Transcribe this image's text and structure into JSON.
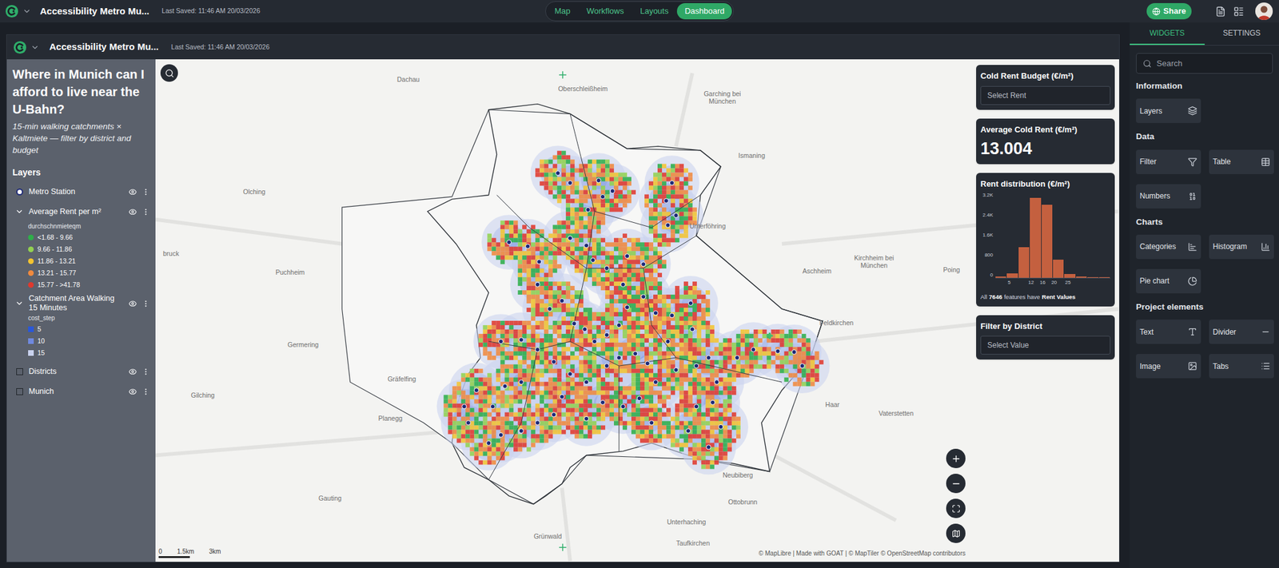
{
  "app_bar": {
    "project_title": "Accessibility Metro Mu...",
    "last_saved": "Last Saved: 11:46 AM 20/03/2026",
    "tabs": [
      {
        "label": "Map",
        "selected": false
      },
      {
        "label": "Workflows",
        "selected": false
      },
      {
        "label": "Layouts",
        "selected": false
      },
      {
        "label": "Dashboard",
        "selected": true
      }
    ],
    "share": "Share"
  },
  "dashboard_header": {
    "project_title": "Accessibility Metro Mu...",
    "last_saved": "Last Saved: 11:46 AM 20/03/2026"
  },
  "left_panel": {
    "title": "Where in Munich can I afford to live near the U-Bahn?",
    "subtitle": "15-min walking catchments × Kaltmiete — filter by district and budget",
    "layers_heading": "Layers",
    "layers": [
      {
        "name": "Metro Station",
        "kind": "point",
        "visible": true,
        "expanded": false,
        "legend": []
      },
      {
        "name": "Average Rent per m²",
        "kind": "fill",
        "visible": true,
        "expanded": true,
        "legend_title": "durchschnmieteqm",
        "legend_swatch": "circle",
        "legend": [
          {
            "label": "<1.68 - 9.66",
            "color": "#2fae4a"
          },
          {
            "label": "9.66 - 11.86",
            "color": "#93d151"
          },
          {
            "label": "11.86 - 13.21",
            "color": "#f3c431"
          },
          {
            "label": "13.21 - 15.77",
            "color": "#f08a3e"
          },
          {
            "label": "15.77 - >41.78",
            "color": "#e0392e"
          }
        ]
      },
      {
        "name": "Catchment Area Walking 15 Minutes",
        "kind": "fill",
        "visible": true,
        "expanded": true,
        "legend_title": "cost_step",
        "legend_swatch": "square",
        "legend": [
          {
            "label": "5",
            "color": "#2a58d8"
          },
          {
            "label": "10",
            "color": "#6f89df"
          },
          {
            "label": "15",
            "color": "#c9d2ee"
          }
        ]
      },
      {
        "name": "Districts",
        "kind": "polygon",
        "visible": true,
        "expanded": false,
        "legend": []
      },
      {
        "name": "Munich",
        "kind": "polygon",
        "visible": true,
        "expanded": false,
        "legend": []
      }
    ]
  },
  "map": {
    "place_labels": [
      "Dachau",
      "Oberschleißheim",
      "Garching bei München",
      "Ismaning",
      "Olching",
      "Unterföhring",
      "bruck",
      "Puchheim",
      "Aschheim",
      "Kirchheim bei München",
      "Poing",
      "Feldkirchen",
      "Germering",
      "Gräfelfing",
      "Gilching",
      "Haar",
      "Vaterstetten",
      "Planegg",
      "Neubiberg",
      "Gauting",
      "Ottobrunn",
      "Unterhaching",
      "Grünwald",
      "Taufkirchen"
    ],
    "scale": [
      "0",
      "1.5km",
      "3km"
    ],
    "attribution": "© MapLibre | Made with GOAT | © MapTiler © OpenStreetMap contributors"
  },
  "map_widgets": [
    {
      "kind": "select",
      "title": "Cold Rent Budget (€/m²)",
      "placeholder": "Select Rent"
    },
    {
      "kind": "number",
      "title": "Average Cold Rent (€/m²)",
      "value": "13.004"
    },
    {
      "kind": "histogram",
      "title": "Rent distribution (€/m²)",
      "y_ticks": [
        "3.2K",
        "2.4K",
        "1.6K",
        "800",
        "0"
      ],
      "x_ticks": [
        "5",
        "12",
        "16",
        "20",
        "25"
      ],
      "values": [
        40,
        150,
        1180,
        3080,
        2820,
        700,
        130,
        30,
        12,
        6
      ],
      "footer_prefix": "All",
      "footer_count": "7646",
      "footer_middle": "features have",
      "footer_field": "Rent Values"
    },
    {
      "kind": "select",
      "title": "Filter by District",
      "placeholder": "Select Value"
    }
  ],
  "sidebar": {
    "tabs": [
      {
        "label": "WIDGETS",
        "selected": true
      },
      {
        "label": "SETTINGS",
        "selected": false
      }
    ],
    "search_placeholder": "Search",
    "sections": [
      {
        "title": "Information",
        "items": [
          "Layers"
        ]
      },
      {
        "title": "Data",
        "items": [
          "Filter",
          "Table",
          "Numbers"
        ]
      },
      {
        "title": "Charts",
        "items": [
          "Categories",
          "Histogram",
          "Pie chart"
        ]
      },
      {
        "title": "Project elements",
        "items": [
          "Text",
          "Divider",
          "Image",
          "Tabs"
        ]
      }
    ]
  }
}
